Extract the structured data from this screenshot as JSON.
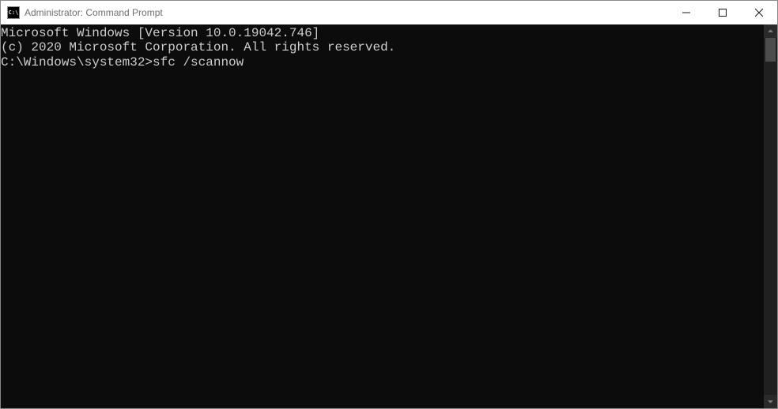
{
  "window": {
    "title": "Administrator: Command Prompt",
    "icon_label": "C:\\"
  },
  "terminal": {
    "lines": [
      "Microsoft Windows [Version 10.0.19042.746]",
      "(c) 2020 Microsoft Corporation. All rights reserved.",
      "",
      "C:\\Windows\\system32>sfc /scannow"
    ],
    "line0": "Microsoft Windows [Version 10.0.19042.746]",
    "line1": "(c) 2020 Microsoft Corporation. All rights reserved.",
    "line2": "",
    "prompt": "C:\\Windows\\system32>",
    "command": "sfc /scannow"
  }
}
